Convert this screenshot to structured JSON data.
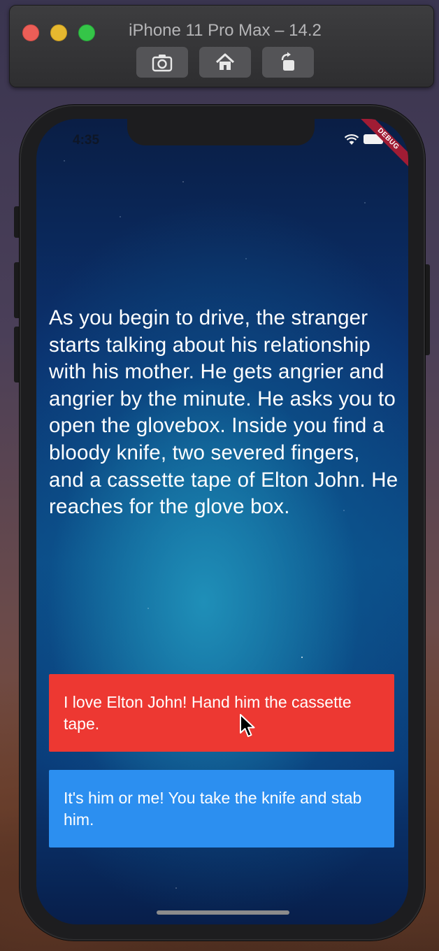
{
  "window": {
    "title": "iPhone 11 Pro Max – 14.2",
    "toolbar": [
      {
        "name": "screenshot-icon"
      },
      {
        "name": "home-icon"
      },
      {
        "name": "rotate-icon"
      }
    ]
  },
  "status_bar": {
    "time": "4:35",
    "debug_banner": "DEBUG"
  },
  "story": {
    "text": "As you begin to drive, the stranger starts talking about his relationship with his mother. He gets angrier and angrier by the minute. He asks you to open the glovebox. Inside you find a bloody knife, two severed fingers, and a cassette tape of Elton John. He reaches for the glove box."
  },
  "choices": [
    {
      "label": "I love Elton John! Hand him the cassette tape.",
      "color": "#ED3832"
    },
    {
      "label": "It's him or me! You take the knife and stab him.",
      "color": "#2C8FF0"
    }
  ]
}
